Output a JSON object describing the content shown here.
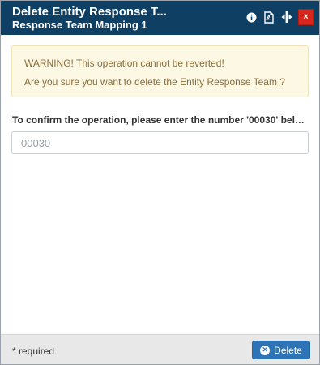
{
  "dialog": {
    "title": "Delete Entity Response T...",
    "subtitle": "Response Team Mapping 1",
    "icons": [
      "info-icon",
      "pdf-icon",
      "resize-horizontal-icon",
      "close-icon"
    ],
    "close_label": "×"
  },
  "warning": {
    "line1": "WARNING! This operation cannot be reverted!",
    "line2": "Are you sure you want to delete the Entity Response Team ?"
  },
  "confirm": {
    "label": "To confirm the operation, please enter the number '00030' belo...",
    "placeholder": "00030",
    "value": ""
  },
  "footer": {
    "required_note": "* required",
    "delete_label": "Delete"
  },
  "colors": {
    "titlebar": "#0f3f63",
    "close": "#d9261c",
    "warning_bg": "#fcf8e3",
    "warning_text": "#8a6d3b",
    "primary_button": "#2d73b6"
  }
}
